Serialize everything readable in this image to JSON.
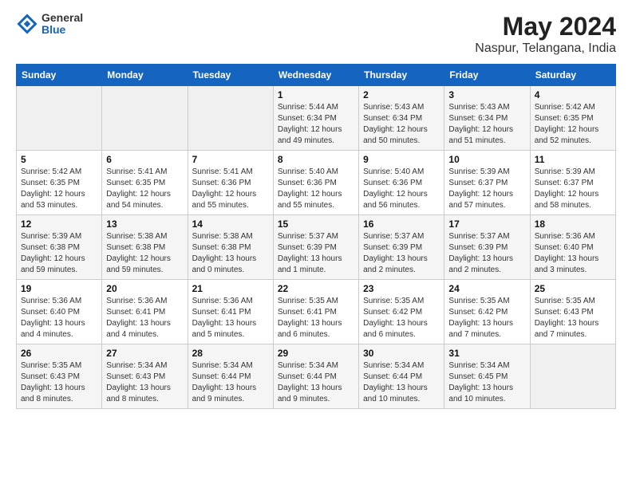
{
  "logo": {
    "general": "General",
    "blue": "Blue"
  },
  "title": "May 2024",
  "subtitle": "Naspur, Telangana, India",
  "headers": [
    "Sunday",
    "Monday",
    "Tuesday",
    "Wednesday",
    "Thursday",
    "Friday",
    "Saturday"
  ],
  "weeks": [
    [
      {
        "day": "",
        "info": ""
      },
      {
        "day": "",
        "info": ""
      },
      {
        "day": "",
        "info": ""
      },
      {
        "day": "1",
        "info": "Sunrise: 5:44 AM\nSunset: 6:34 PM\nDaylight: 12 hours\nand 49 minutes."
      },
      {
        "day": "2",
        "info": "Sunrise: 5:43 AM\nSunset: 6:34 PM\nDaylight: 12 hours\nand 50 minutes."
      },
      {
        "day": "3",
        "info": "Sunrise: 5:43 AM\nSunset: 6:34 PM\nDaylight: 12 hours\nand 51 minutes."
      },
      {
        "day": "4",
        "info": "Sunrise: 5:42 AM\nSunset: 6:35 PM\nDaylight: 12 hours\nand 52 minutes."
      }
    ],
    [
      {
        "day": "5",
        "info": "Sunrise: 5:42 AM\nSunset: 6:35 PM\nDaylight: 12 hours\nand 53 minutes."
      },
      {
        "day": "6",
        "info": "Sunrise: 5:41 AM\nSunset: 6:35 PM\nDaylight: 12 hours\nand 54 minutes."
      },
      {
        "day": "7",
        "info": "Sunrise: 5:41 AM\nSunset: 6:36 PM\nDaylight: 12 hours\nand 55 minutes."
      },
      {
        "day": "8",
        "info": "Sunrise: 5:40 AM\nSunset: 6:36 PM\nDaylight: 12 hours\nand 55 minutes."
      },
      {
        "day": "9",
        "info": "Sunrise: 5:40 AM\nSunset: 6:36 PM\nDaylight: 12 hours\nand 56 minutes."
      },
      {
        "day": "10",
        "info": "Sunrise: 5:39 AM\nSunset: 6:37 PM\nDaylight: 12 hours\nand 57 minutes."
      },
      {
        "day": "11",
        "info": "Sunrise: 5:39 AM\nSunset: 6:37 PM\nDaylight: 12 hours\nand 58 minutes."
      }
    ],
    [
      {
        "day": "12",
        "info": "Sunrise: 5:39 AM\nSunset: 6:38 PM\nDaylight: 12 hours\nand 59 minutes."
      },
      {
        "day": "13",
        "info": "Sunrise: 5:38 AM\nSunset: 6:38 PM\nDaylight: 12 hours\nand 59 minutes."
      },
      {
        "day": "14",
        "info": "Sunrise: 5:38 AM\nSunset: 6:38 PM\nDaylight: 13 hours\nand 0 minutes."
      },
      {
        "day": "15",
        "info": "Sunrise: 5:37 AM\nSunset: 6:39 PM\nDaylight: 13 hours\nand 1 minute."
      },
      {
        "day": "16",
        "info": "Sunrise: 5:37 AM\nSunset: 6:39 PM\nDaylight: 13 hours\nand 2 minutes."
      },
      {
        "day": "17",
        "info": "Sunrise: 5:37 AM\nSunset: 6:39 PM\nDaylight: 13 hours\nand 2 minutes."
      },
      {
        "day": "18",
        "info": "Sunrise: 5:36 AM\nSunset: 6:40 PM\nDaylight: 13 hours\nand 3 minutes."
      }
    ],
    [
      {
        "day": "19",
        "info": "Sunrise: 5:36 AM\nSunset: 6:40 PM\nDaylight: 13 hours\nand 4 minutes."
      },
      {
        "day": "20",
        "info": "Sunrise: 5:36 AM\nSunset: 6:41 PM\nDaylight: 13 hours\nand 4 minutes."
      },
      {
        "day": "21",
        "info": "Sunrise: 5:36 AM\nSunset: 6:41 PM\nDaylight: 13 hours\nand 5 minutes."
      },
      {
        "day": "22",
        "info": "Sunrise: 5:35 AM\nSunset: 6:41 PM\nDaylight: 13 hours\nand 6 minutes."
      },
      {
        "day": "23",
        "info": "Sunrise: 5:35 AM\nSunset: 6:42 PM\nDaylight: 13 hours\nand 6 minutes."
      },
      {
        "day": "24",
        "info": "Sunrise: 5:35 AM\nSunset: 6:42 PM\nDaylight: 13 hours\nand 7 minutes."
      },
      {
        "day": "25",
        "info": "Sunrise: 5:35 AM\nSunset: 6:43 PM\nDaylight: 13 hours\nand 7 minutes."
      }
    ],
    [
      {
        "day": "26",
        "info": "Sunrise: 5:35 AM\nSunset: 6:43 PM\nDaylight: 13 hours\nand 8 minutes."
      },
      {
        "day": "27",
        "info": "Sunrise: 5:34 AM\nSunset: 6:43 PM\nDaylight: 13 hours\nand 8 minutes."
      },
      {
        "day": "28",
        "info": "Sunrise: 5:34 AM\nSunset: 6:44 PM\nDaylight: 13 hours\nand 9 minutes."
      },
      {
        "day": "29",
        "info": "Sunrise: 5:34 AM\nSunset: 6:44 PM\nDaylight: 13 hours\nand 9 minutes."
      },
      {
        "day": "30",
        "info": "Sunrise: 5:34 AM\nSunset: 6:44 PM\nDaylight: 13 hours\nand 10 minutes."
      },
      {
        "day": "31",
        "info": "Sunrise: 5:34 AM\nSunset: 6:45 PM\nDaylight: 13 hours\nand 10 minutes."
      },
      {
        "day": "",
        "info": ""
      }
    ]
  ]
}
